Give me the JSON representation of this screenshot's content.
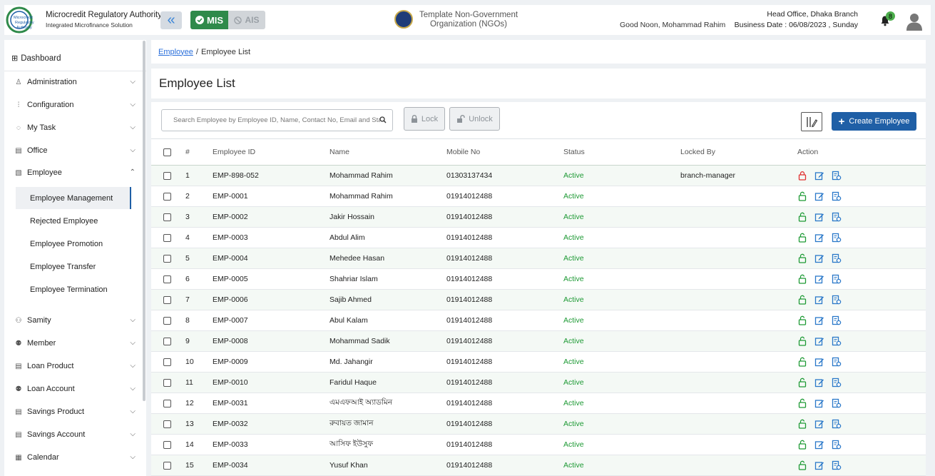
{
  "header": {
    "brand_title": "Microcredit Regulatory Authority",
    "brand_subtitle": "Integrated Microfinance Solution",
    "collapse_icon": "double-chevron-left-icon",
    "mis_label": "MIS",
    "ais_label": "AIS",
    "org_name": "Template Non-Government Organization (NGOs)",
    "greeting": "Good Noon, Mohammad Rahim",
    "branch": "Head Office, Dhaka Branch",
    "business_date": "Business Date : 06/08/2023 , Sunday",
    "notification_count": "8"
  },
  "sidebar": {
    "dashboard": "Dashboard",
    "items_top": [
      {
        "label": "Administration",
        "icon": "user-cog-icon"
      },
      {
        "label": "Configuration",
        "icon": "sliders-icon"
      },
      {
        "label": "My Task",
        "icon": "circle-dashed-icon"
      },
      {
        "label": "Office",
        "icon": "building-icon"
      },
      {
        "label": "Employee",
        "icon": "id-card-icon"
      }
    ],
    "employee_sub": [
      "Employee Management",
      "Rejected Employee",
      "Employee Promotion",
      "Employee Transfer",
      "Employee Termination"
    ],
    "items_bottom": [
      {
        "label": "Samity",
        "icon": "group-icon"
      },
      {
        "label": "Member",
        "icon": "users-icon"
      },
      {
        "label": "Loan Product",
        "icon": "document-icon"
      },
      {
        "label": "Loan Account",
        "icon": "users-icon"
      },
      {
        "label": "Savings Product",
        "icon": "document-icon"
      },
      {
        "label": "Savings Account",
        "icon": "document-icon"
      },
      {
        "label": "Calendar",
        "icon": "calendar-icon"
      }
    ]
  },
  "breadcrumb": {
    "parent": "Employee",
    "separator": "/",
    "current": "Employee List"
  },
  "page_title": "Employee List",
  "toolbar": {
    "search_placeholder": "Search Employee by Employee ID, Name, Contact No, Email and Status",
    "lock_label": "Lock",
    "unlock_label": "Unlock",
    "create_label": "Create Employee"
  },
  "table": {
    "columns": [
      "#",
      "Employee ID",
      "Name",
      "Mobile No",
      "Status",
      "Locked By",
      "Action"
    ],
    "rows": [
      {
        "num": "1",
        "id": "EMP-898-052",
        "name": "Mohammad Rahim",
        "mobile": "01303137434",
        "status": "Active",
        "locked_by": "branch-manager",
        "locked": true
      },
      {
        "num": "2",
        "id": "EMP-0001",
        "name": "Mohammad Rahim",
        "mobile": "01914012488",
        "status": "Active",
        "locked_by": "",
        "locked": false
      },
      {
        "num": "3",
        "id": "EMP-0002",
        "name": "Jakir Hossain",
        "mobile": "01914012488",
        "status": "Active",
        "locked_by": "",
        "locked": false
      },
      {
        "num": "4",
        "id": "EMP-0003",
        "name": "Abdul Alim",
        "mobile": "01914012488",
        "status": "Active",
        "locked_by": "",
        "locked": false
      },
      {
        "num": "5",
        "id": "EMP-0004",
        "name": "Mehedee Hasan",
        "mobile": "01914012488",
        "status": "Active",
        "locked_by": "",
        "locked": false
      },
      {
        "num": "6",
        "id": "EMP-0005",
        "name": "Shahriar Islam",
        "mobile": "01914012488",
        "status": "Active",
        "locked_by": "",
        "locked": false
      },
      {
        "num": "7",
        "id": "EMP-0006",
        "name": "Sajib Ahmed",
        "mobile": "01914012488",
        "status": "Active",
        "locked_by": "",
        "locked": false
      },
      {
        "num": "8",
        "id": "EMP-0007",
        "name": "Abul Kalam",
        "mobile": "01914012488",
        "status": "Active",
        "locked_by": "",
        "locked": false
      },
      {
        "num": "9",
        "id": "EMP-0008",
        "name": "Mohammad Sadik",
        "mobile": "01914012488",
        "status": "Active",
        "locked_by": "",
        "locked": false
      },
      {
        "num": "10",
        "id": "EMP-0009",
        "name": "Md. Jahangir",
        "mobile": "01914012488",
        "status": "Active",
        "locked_by": "",
        "locked": false
      },
      {
        "num": "11",
        "id": "EMP-0010",
        "name": "Faridul Haque",
        "mobile": "01914012488",
        "status": "Active",
        "locked_by": "",
        "locked": false
      },
      {
        "num": "12",
        "id": "EMP-0031",
        "name": "এমএফআই অ্যাডমিন",
        "mobile": "01914012488",
        "status": "Active",
        "locked_by": "",
        "locked": false
      },
      {
        "num": "13",
        "id": "EMP-0032",
        "name": "রুবায়ত জামান",
        "mobile": "01914012488",
        "status": "Active",
        "locked_by": "",
        "locked": false
      },
      {
        "num": "14",
        "id": "EMP-0033",
        "name": "আসিফ ইউসুফ",
        "mobile": "01914012488",
        "status": "Active",
        "locked_by": "",
        "locked": false
      },
      {
        "num": "15",
        "id": "EMP-0034",
        "name": "Yusuf Khan",
        "mobile": "01914012488",
        "status": "Active",
        "locked_by": "",
        "locked": false
      }
    ]
  },
  "colors": {
    "primary": "#1f5fa6",
    "mis_green": "#2f8a4a",
    "active_green": "#1e9a35",
    "locked_red": "#e03131",
    "action_blue": "#2a78c9"
  }
}
